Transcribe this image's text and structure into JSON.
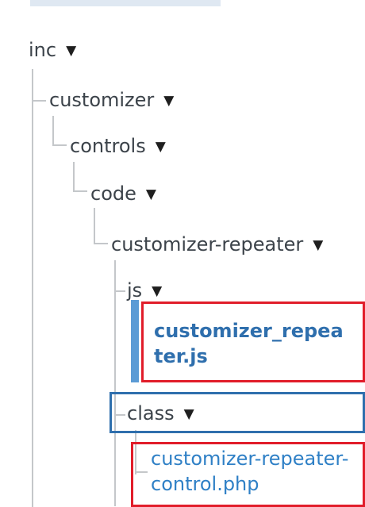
{
  "tree": {
    "folders": [
      {
        "label": "inc"
      },
      {
        "label": "customizer"
      },
      {
        "label": "controls"
      },
      {
        "label": "code"
      },
      {
        "label": "customizer-repeater"
      },
      {
        "label": "js"
      },
      {
        "label": "class"
      }
    ],
    "files": [
      {
        "label_line1": "customizer_repea",
        "label_line2": "ter.js"
      },
      {
        "label_line1": "customizer-repeater-",
        "label_line2": "control.php"
      }
    ],
    "expand_icon": "triangle-down-icon"
  }
}
